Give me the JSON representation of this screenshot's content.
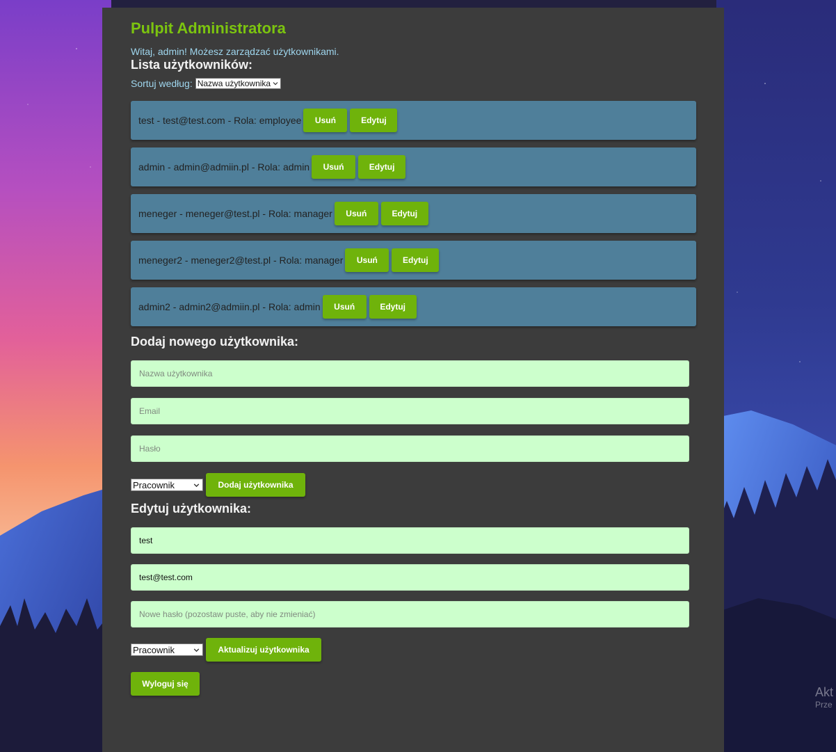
{
  "page": {
    "title": "Pulpit Administratora",
    "welcome": "Witaj, admin! Możesz zarządzać użytkownikami."
  },
  "user_list": {
    "heading": "Lista użytkowników:",
    "sort_label": "Sortuj według:",
    "sort_value": "Nazwa użytkownika",
    "delete_label": "Usuń",
    "edit_label": "Edytuj",
    "users": [
      {
        "text": "test - test@test.com - Rola: employee"
      },
      {
        "text": "admin - admin@admiin.pl - Rola: admin"
      },
      {
        "text": "meneger - meneger@test.pl - Rola: manager"
      },
      {
        "text": "meneger2 - meneger2@test.pl - Rola: manager"
      },
      {
        "text": "admin2 - admin2@admiin.pl - Rola: admin"
      }
    ]
  },
  "add_user": {
    "heading": "Dodaj nowego użytkownika:",
    "username_placeholder": "Nazwa użytkownika",
    "email_placeholder": "Email",
    "password_placeholder": "Hasło",
    "role_value": "Pracownik",
    "submit_label": "Dodaj użytkownika"
  },
  "edit_user": {
    "heading": "Edytuj użytkownika:",
    "username_value": "test",
    "email_value": "test@test.com",
    "password_placeholder": "Nowe hasło (pozostaw puste, aby nie zmieniać)",
    "role_value": "Pracownik",
    "submit_label": "Aktualizuj użytkownika"
  },
  "logout_label": "Wyloguj się",
  "watermark": {
    "line1": "Akt",
    "line2": "Prze"
  },
  "colors": {
    "accent_green": "#6fb30b",
    "title_green": "#7cc40f",
    "panel": "#3c3c3c",
    "user_row": "#4f7f9a",
    "input_bg": "#ccffcc",
    "welcome_text": "#9fd6ee"
  }
}
